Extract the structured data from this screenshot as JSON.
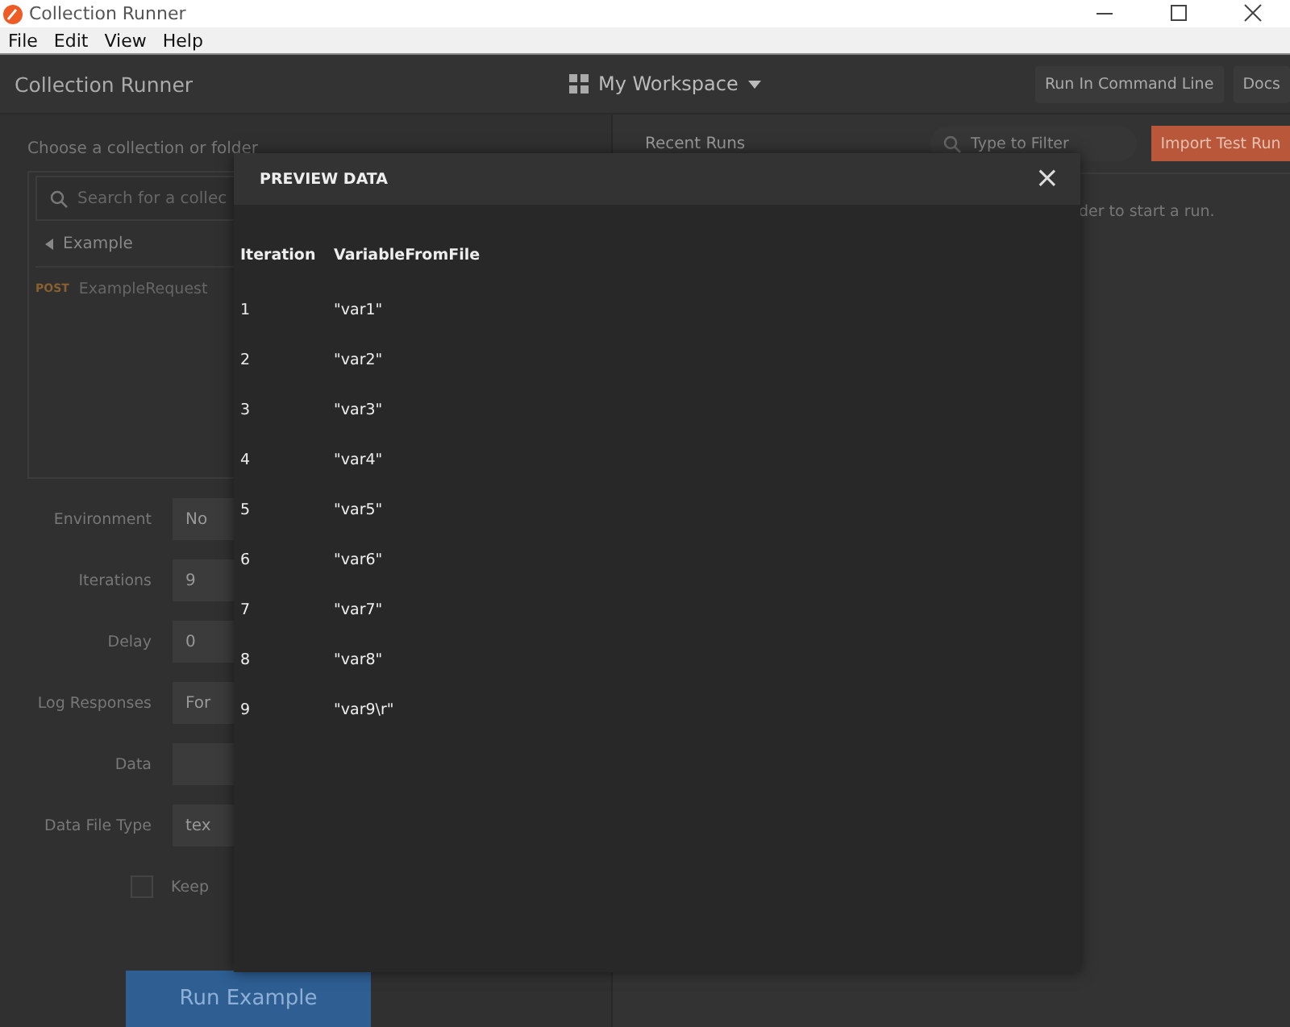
{
  "window": {
    "title": "Collection Runner"
  },
  "menu": [
    "File",
    "Edit",
    "View",
    "Help"
  ],
  "header": {
    "title": "Collection Runner",
    "workspace": "My Workspace",
    "buttons": [
      "Run In Command Line",
      "Docs"
    ]
  },
  "left": {
    "prompt": "Choose a collection or folder",
    "search": {
      "placeholder": "Search for a collec"
    },
    "collection": {
      "name": "Example",
      "expanded": false
    },
    "requests": [
      {
        "method": "POST",
        "name": "ExampleRequest"
      }
    ],
    "settings": [
      {
        "label": "Environment",
        "kind": "select",
        "value": "No"
      },
      {
        "label": "Iterations",
        "kind": "input",
        "value": "9"
      },
      {
        "label": "Delay",
        "kind": "input",
        "value": "0"
      },
      {
        "label": "Log Responses",
        "kind": "select",
        "value": "For"
      },
      {
        "label": "Data",
        "kind": "button"
      },
      {
        "label": "Data File Type",
        "kind": "select",
        "value": "tex"
      },
      {
        "label": "Keep",
        "kind": "checkbox",
        "checked": false
      }
    ],
    "run_button": "Run Example"
  },
  "right": {
    "title": "Recent Runs",
    "filter": {
      "placeholder": "Type to Filter"
    },
    "import_button": "Import Test Run",
    "message": "der to start a run."
  },
  "modal": {
    "title": "PREVIEW DATA",
    "close": "×",
    "columns": [
      "Iteration",
      "VariableFromFile"
    ],
    "rows": [
      [
        "1",
        "\"var1\""
      ],
      [
        "2",
        "\"var2\""
      ],
      [
        "3",
        "\"var3\""
      ],
      [
        "4",
        "\"var4\""
      ],
      [
        "5",
        "\"var5\""
      ],
      [
        "6",
        "\"var6\""
      ],
      [
        "7",
        "\"var7\""
      ],
      [
        "8",
        "\"var8\""
      ],
      [
        "9",
        "\"var9\\r\""
      ]
    ]
  }
}
